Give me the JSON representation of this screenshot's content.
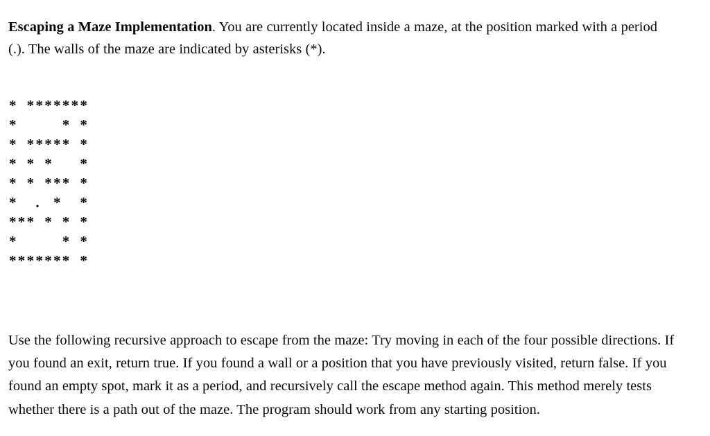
{
  "document": {
    "intro": {
      "lead_label": "Escaping a Maze Implementation",
      "lead_suffix": ".",
      "text": "  You are currently located inside a maze, at the position marked with a period (.).  The walls of the maze are indicated by asterisks (*)."
    },
    "maze": {
      "wall_char": "*",
      "marker_char": ".",
      "empty_char": " ",
      "columns": 9,
      "rows_count": 9,
      "rows": [
        "* *******",
        "*     * *",
        "* ***** *",
        "* * *   *",
        "* * *** *",
        "*  . *  *",
        "*** * * *",
        "*     * *",
        "******* *"
      ]
    },
    "body": {
      "text": "Use the following recursive approach to escape from the maze: Try moving in each of the four possible directions.  If you found an exit, return true.  If you found a wall or a position that you have previously visited, return false.  If you found an empty spot, mark it as a period, and recursively call the escape method again.  This method merely tests whether there is a path out of the maze.  The program should work from any starting position."
    }
  }
}
